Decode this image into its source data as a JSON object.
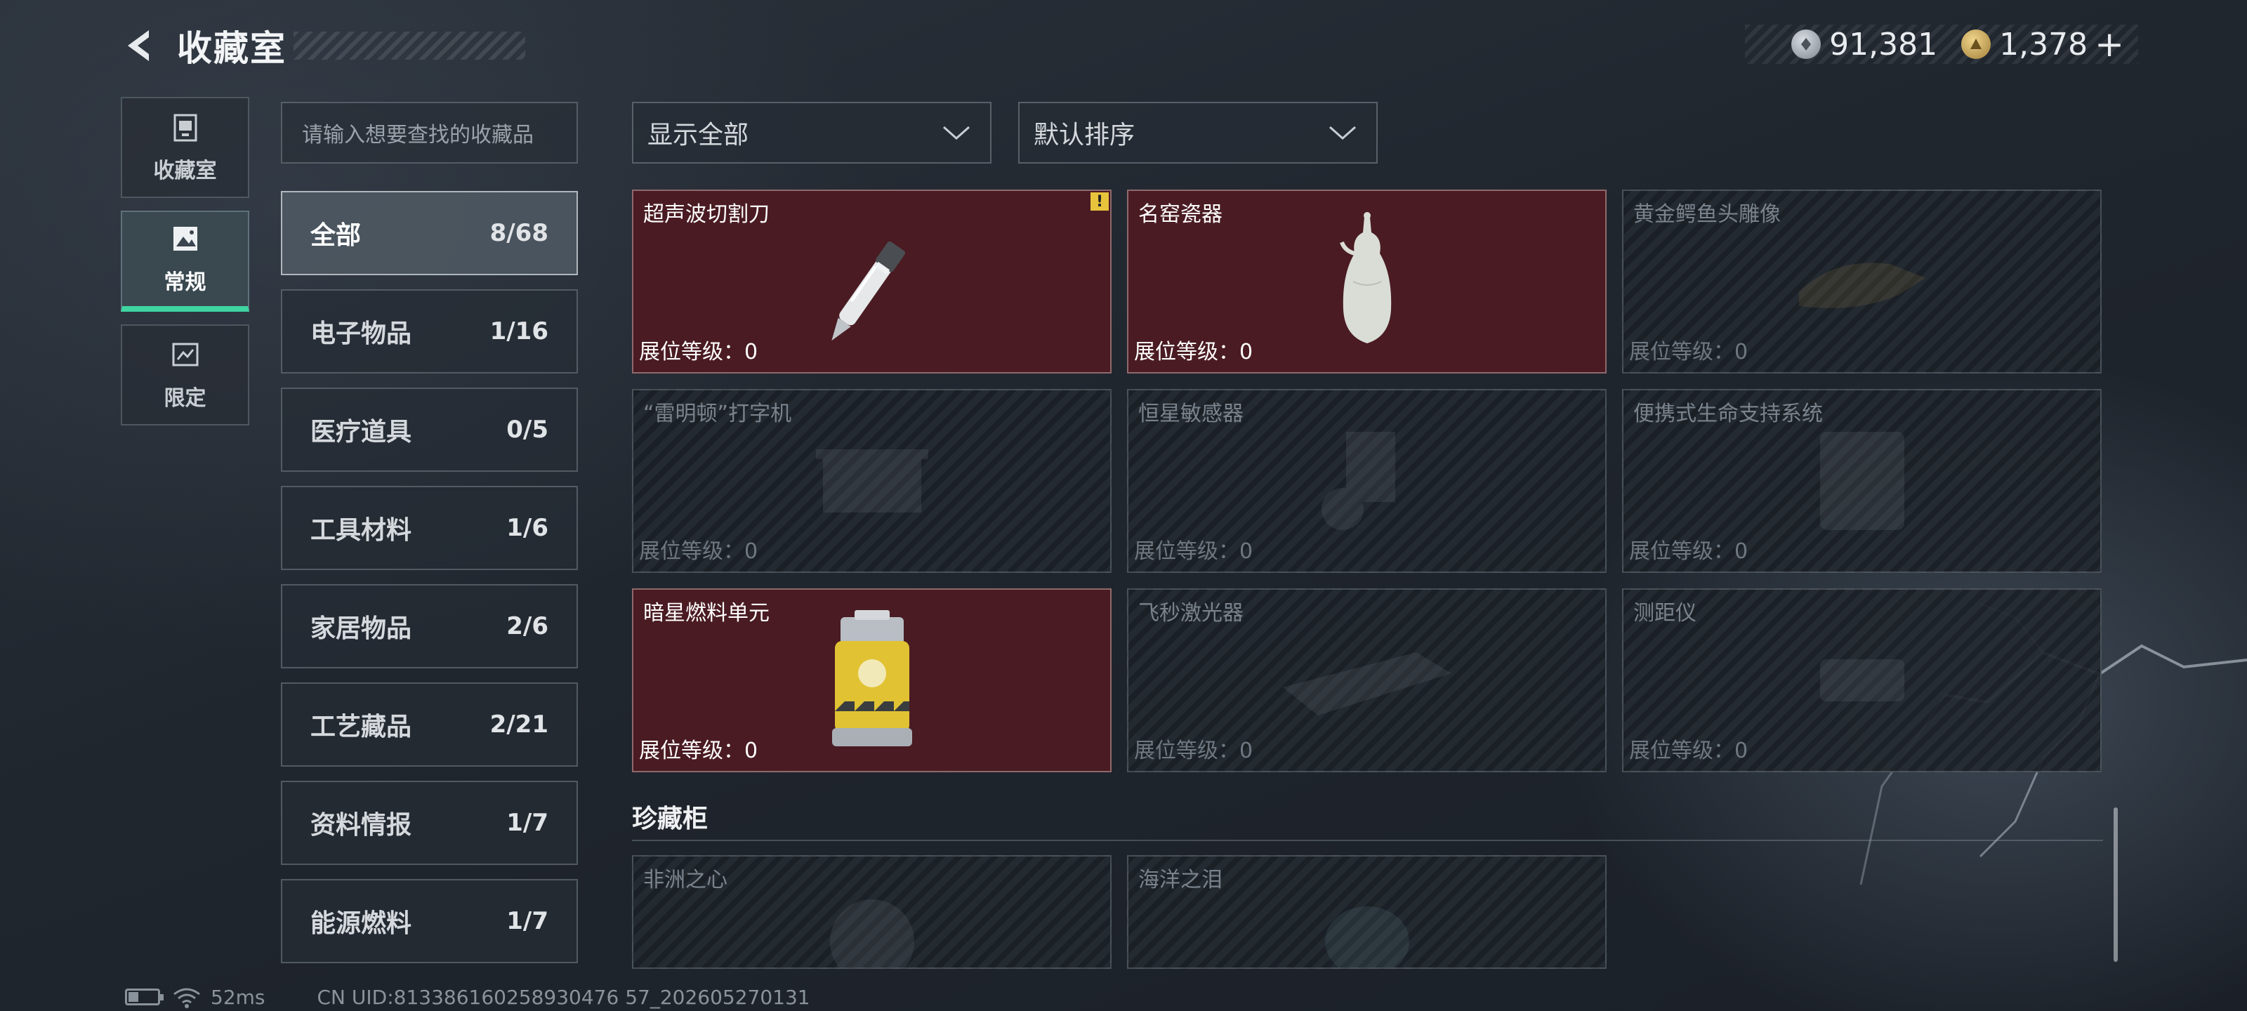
{
  "header": {
    "title": "收藏室"
  },
  "currency": {
    "silver": "91,381",
    "gold": "1,378",
    "add_label": "+"
  },
  "left_nav": [
    {
      "label": "收藏室",
      "icon": "vault-icon",
      "active": false
    },
    {
      "label": "常规",
      "icon": "landscape-icon",
      "active": true
    },
    {
      "label": "限定",
      "icon": "limited-icon",
      "active": false
    }
  ],
  "search": {
    "placeholder": "请输入想要查找的收藏品"
  },
  "categories": [
    {
      "name": "全部",
      "count": "8/68",
      "active": true
    },
    {
      "name": "电子物品",
      "count": "1/16"
    },
    {
      "name": "医疗道具",
      "count": "0/5"
    },
    {
      "name": "工具材料",
      "count": "1/6"
    },
    {
      "name": "家居物品",
      "count": "2/6"
    },
    {
      "name": "工艺藏品",
      "count": "2/21"
    },
    {
      "name": "资料情报",
      "count": "1/7"
    },
    {
      "name": "能源燃料",
      "count": "1/7"
    }
  ],
  "filters": {
    "display": "显示全部",
    "sort": "默认排序"
  },
  "items": [
    {
      "name": "超声波切割刀",
      "level": "展位等级：0",
      "owned": true,
      "icon": "ultrasonic-knife-icon",
      "alert": "!"
    },
    {
      "name": "名窑瓷器",
      "level": "展位等级：0",
      "owned": true,
      "icon": "porcelain-vase-icon"
    },
    {
      "name": "黄金鳄鱼头雕像",
      "level": "展位等级：0",
      "owned": false,
      "icon": "crocodile-statue-icon"
    },
    {
      "name": "“雷明顿”打字机",
      "level": "展位等级：0",
      "owned": false,
      "icon": "typewriter-icon"
    },
    {
      "name": "恒星敏感器",
      "level": "展位等级：0",
      "owned": false,
      "icon": "star-sensor-icon"
    },
    {
      "name": "便携式生命支持系统",
      "level": "展位等级：0",
      "owned": false,
      "icon": "life-support-icon"
    },
    {
      "name": "暗星燃料单元",
      "level": "展位等级：0",
      "owned": true,
      "icon": "fuel-cell-icon"
    },
    {
      "name": "飞秒激光器",
      "level": "展位等级：0",
      "owned": false,
      "icon": "laser-icon"
    },
    {
      "name": "测距仪",
      "level": "展位等级：0",
      "owned": false,
      "icon": "rangefinder-icon"
    }
  ],
  "treasure_section": {
    "title": "珍藏柜",
    "items": [
      {
        "name": "非洲之心",
        "owned": false,
        "icon": "gem-icon"
      },
      {
        "name": "海洋之泪",
        "owned": false,
        "icon": "gem-icon"
      }
    ]
  },
  "status": {
    "ping": "52ms",
    "uid": "CN UID:813386160258930476 57_202605270131"
  },
  "colors": {
    "accent": "#3fd6a2",
    "owned_card": "#4a1b22",
    "alert": "#e8c43c"
  }
}
